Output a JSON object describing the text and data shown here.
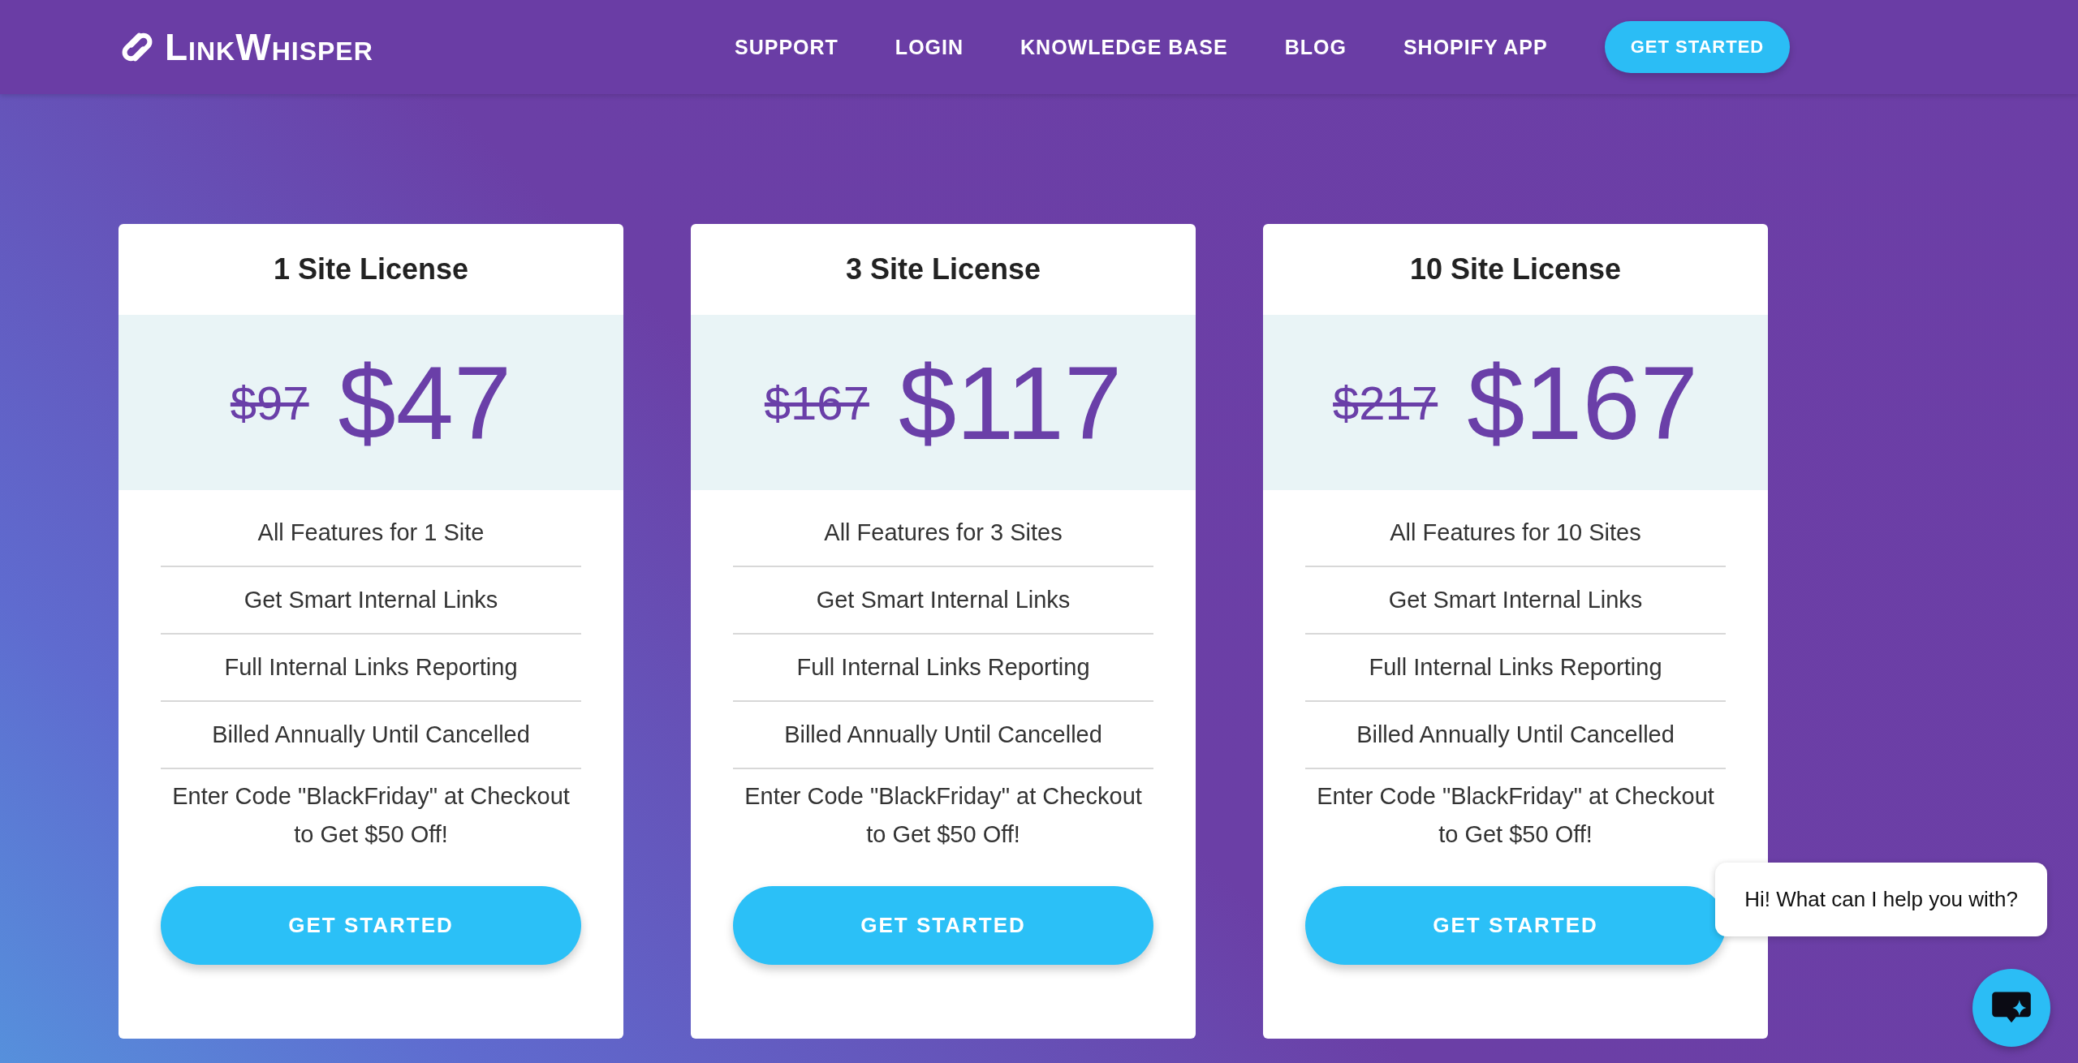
{
  "header": {
    "logo": "LinkWhisper",
    "nav": [
      {
        "label": "SUPPORT",
        "kind": "link"
      },
      {
        "label": "LOGIN",
        "kind": "link"
      },
      {
        "label": "KNOWLEDGE BASE",
        "kind": "link"
      },
      {
        "label": "BLOG",
        "kind": "link"
      },
      {
        "label": "SHOPIFY APP",
        "kind": "link"
      },
      {
        "label": "GET STARTED",
        "kind": "button"
      }
    ]
  },
  "plans": [
    {
      "title": "1 Site License",
      "old_price": "$97",
      "price": "$47",
      "features": [
        "All Features for 1 Site",
        "Get Smart Internal Links",
        "Full Internal Links Reporting",
        "Billed Annually Until Cancelled",
        "Enter Code \"BlackFriday\" at Checkout to Get $50 Off!"
      ],
      "button": "GET STARTED"
    },
    {
      "title": "3 Site License",
      "old_price": "$167",
      "price": "$117",
      "features": [
        "All Features for 3 Sites",
        "Get Smart Internal Links",
        "Full Internal Links Reporting",
        "Billed Annually Until Cancelled",
        "Enter Code \"BlackFriday\" at Checkout to Get $50 Off!"
      ],
      "button": "GET STARTED"
    },
    {
      "title": "10 Site License",
      "old_price": "$217",
      "price": "$167",
      "features": [
        "All Features for 10 Sites",
        "Get Smart Internal Links",
        "Full Internal Links Reporting",
        "Billed Annually Until Cancelled",
        "Enter Code \"BlackFriday\" at Checkout to Get $50 Off!"
      ],
      "button": "GET STARTED"
    }
  ],
  "chat": {
    "message": "Hi! What can I help you with?"
  }
}
